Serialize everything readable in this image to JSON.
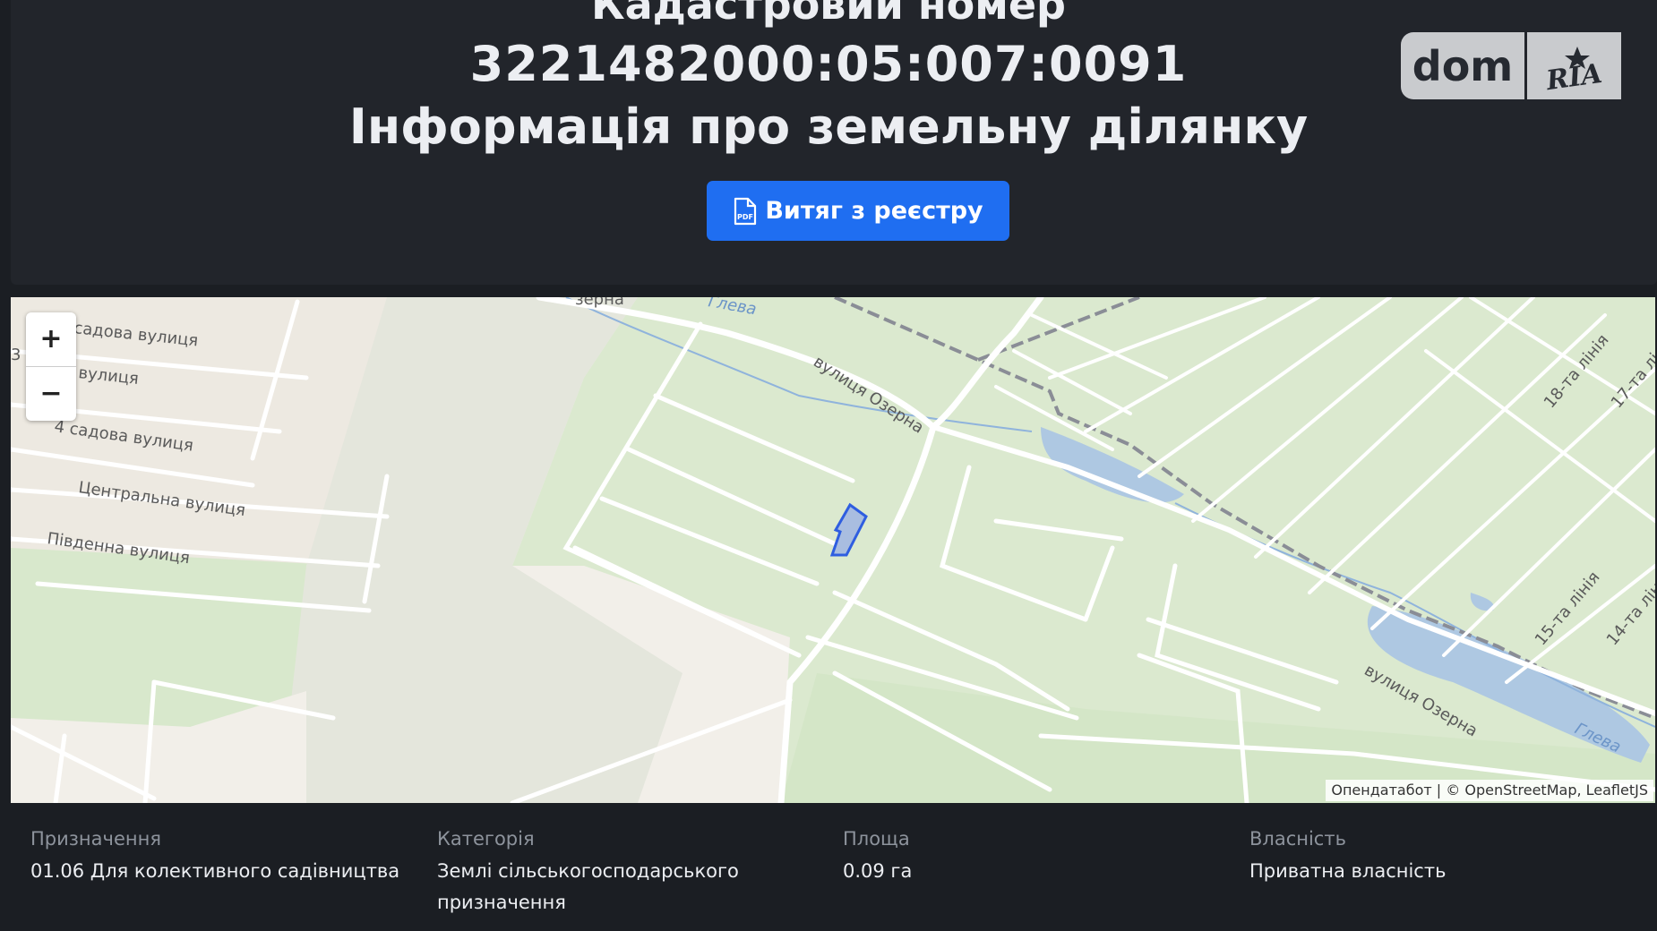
{
  "header": {
    "title_line1": "Кадастровий номер",
    "cadastral_number": "3221482000:05:007:0091",
    "subtitle": "Інформація про земельну ділянку",
    "pdf_button_label": "Витяг з реєстру",
    "pdf_icon_text": "PDF"
  },
  "logo": {
    "left_text": "dom",
    "right_text": "RIA"
  },
  "map": {
    "zoom_in": "+",
    "zoom_out": "−",
    "attribution": "Опендатабот | © OpenStreetMap, LeafletJS",
    "labels": {
      "ozerna_top": "зерна",
      "hleva_top": "Глева",
      "sadova": "садова вулиця",
      "vulytsia_3": "вулиця",
      "three": "3",
      "sadova4": "4 садова вулиця",
      "tsentralna": "Центральна вулиця",
      "pivdenna": "Південна вулиця",
      "ozerna_mid": "вулиця Озерна",
      "ozerna_right": "вулиця Озерна",
      "hleva_right": "Глева",
      "line18": "18-та лінія",
      "line17": "17-та лі",
      "line15": "15-та лінія",
      "line14": "14-та лін"
    },
    "colors": {
      "parcel": "#2f5ee0",
      "green": "#dde9d1",
      "water": "#aec8e2"
    }
  },
  "info": [
    {
      "label": "Призначення",
      "value": "01.06 Для колективного садівництва"
    },
    {
      "label": "Категорія",
      "value": "Землі сільськогосподарського призначення"
    },
    {
      "label": "Площа",
      "value": "0.09 га"
    },
    {
      "label": "Власність",
      "value": "Приватна власність"
    }
  ]
}
